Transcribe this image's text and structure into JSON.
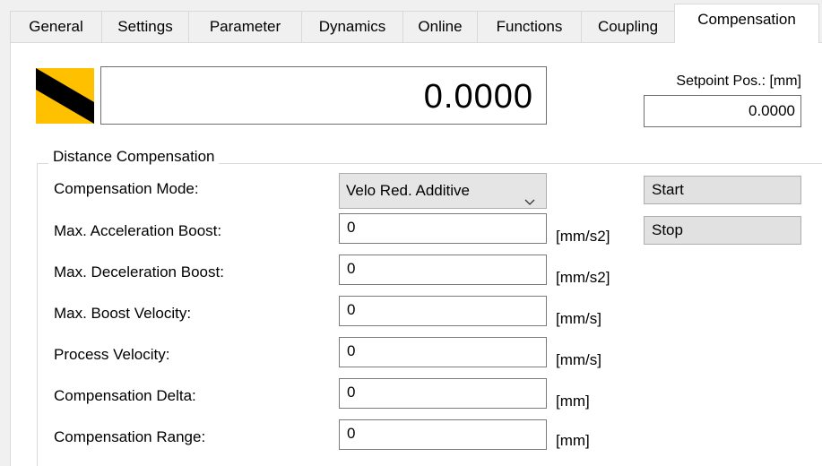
{
  "tabs": [
    {
      "label": "General"
    },
    {
      "label": "Settings"
    },
    {
      "label": "Parameter"
    },
    {
      "label": "Dynamics"
    },
    {
      "label": "Online"
    },
    {
      "label": "Functions"
    },
    {
      "label": "Coupling"
    },
    {
      "label": "Compensation",
      "active": true
    }
  ],
  "status": {
    "icon": "axis-status-stripe-icon",
    "colors": {
      "yellow": "#ffc000",
      "black": "#000000"
    }
  },
  "position": {
    "value": "0.0000"
  },
  "setpoint": {
    "label": "Setpoint Pos.:  [mm]",
    "value": "0.0000"
  },
  "distance_compensation": {
    "title": "Distance Compensation",
    "mode": {
      "label": "Compensation Mode:",
      "selected": "Velo Red. Additive"
    },
    "fields": [
      {
        "label": "Max. Acceleration Boost:",
        "value": "0",
        "unit": "[mm/s2]"
      },
      {
        "label": "Max. Deceleration Boost:",
        "value": "0",
        "unit": "[mm/s2]"
      },
      {
        "label": "Max. Boost Velocity:",
        "value": "0",
        "unit": "[mm/s]"
      },
      {
        "label": "Process Velocity:",
        "value": "0",
        "unit": "[mm/s]"
      },
      {
        "label": "Compensation Delta:",
        "value": "0",
        "unit": "[mm]"
      },
      {
        "label": "Compensation Range:",
        "value": "0",
        "unit": "[mm]"
      }
    ],
    "buttons": {
      "start": "Start",
      "stop": "Stop"
    }
  }
}
